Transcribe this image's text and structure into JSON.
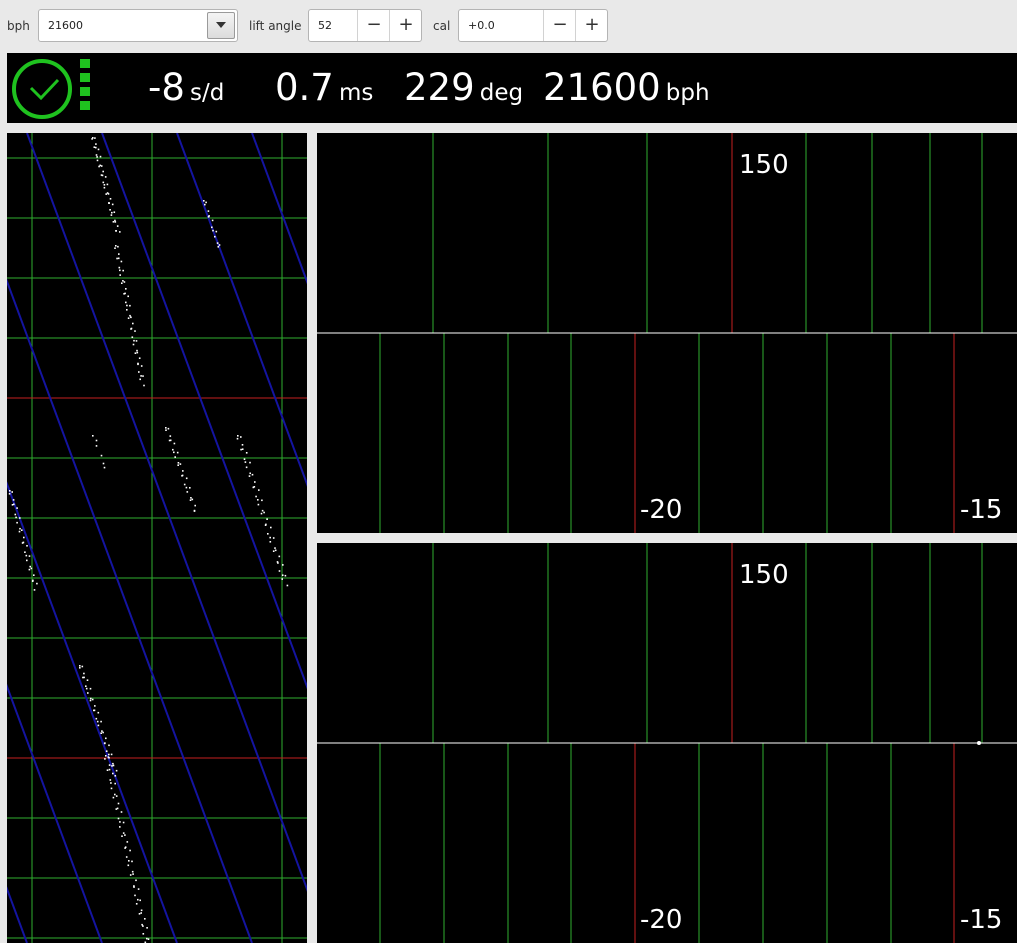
{
  "toolbar": {
    "bph_label": "bph",
    "bph_value": "21600",
    "lift_angle_label": "lift angle",
    "lift_angle_value": "52",
    "cal_label": "cal",
    "cal_value": "+0.0",
    "minus_symbol": "−",
    "plus_symbol": "+"
  },
  "status": {
    "rate_value": "-8",
    "rate_unit": "s/d",
    "beat_error_value": "0.7",
    "beat_error_unit": "ms",
    "amplitude_value": "229",
    "amplitude_unit": "deg",
    "bph_value": "21600",
    "bph_unit": "bph",
    "icon": "clock-icon",
    "signal_icon": "signal-bars-icon",
    "accent_color": "#1fc21f"
  },
  "waveforms": [
    {
      "top_label": "150",
      "left_label": "-20",
      "right_label": "-15"
    },
    {
      "top_label": "150",
      "left_label": "-20",
      "right_label": "-15"
    }
  ],
  "colors": {
    "grid_green": "#2fae2f",
    "marker_red": "#c42020",
    "trace_blue": "#1414a0",
    "points_white": "#ffffff",
    "background": "#000000"
  }
}
